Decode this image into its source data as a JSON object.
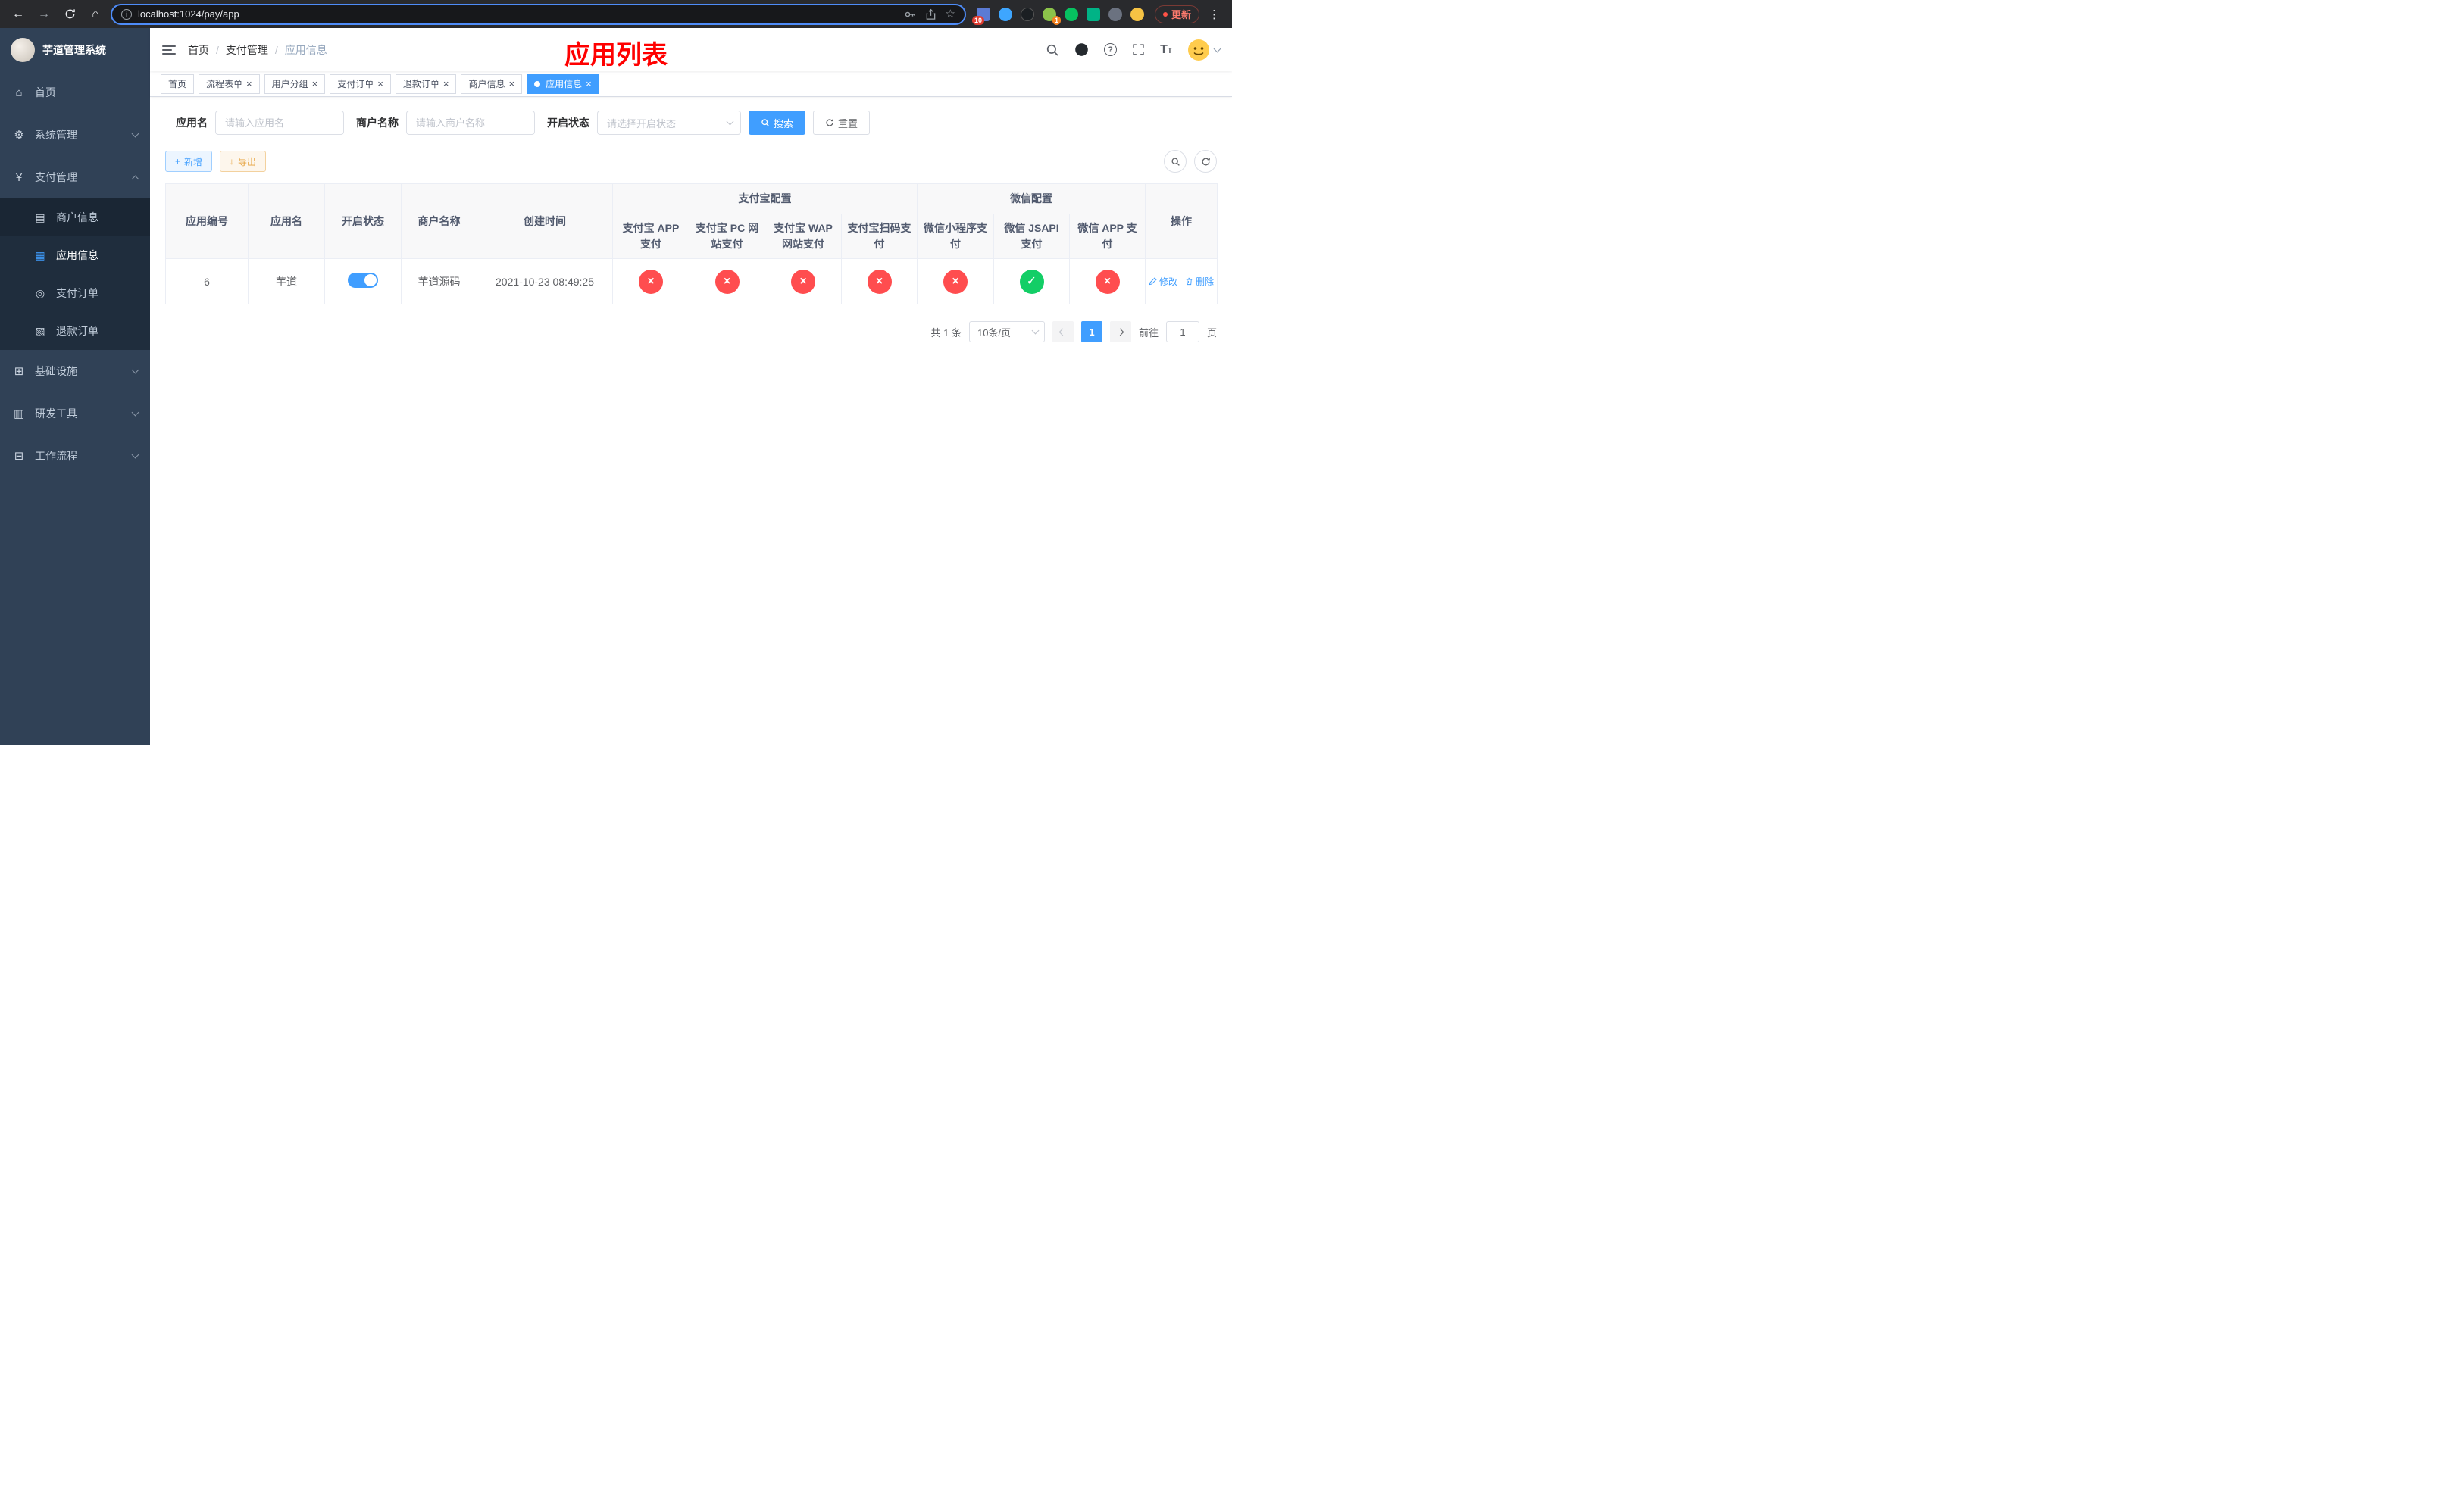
{
  "theme": {
    "accent": "#409eff",
    "sidebar_bg": "#304156",
    "submenu_bg": "#1f2d3d",
    "danger": "#ff4d4f",
    "success": "#13ce66",
    "overlay_title_color": "#ff0000"
  },
  "icons": {
    "close": "×",
    "check": "✓",
    "back": "←",
    "forward": "→",
    "home": "⌂",
    "star": "☆",
    "info": "i",
    "dots": "⋮",
    "question": "?",
    "font_large": "T",
    "font_small": "T"
  },
  "browser": {
    "url": "localhost:1024/pay/app",
    "update_label": "更新",
    "ext_badge_count": "10",
    "ext_badge_single": "1"
  },
  "sidebar": {
    "title": "芋道管理系统",
    "items": [
      {
        "label": "首页",
        "icon": "⌂"
      },
      {
        "label": "系统管理",
        "icon": "⚙"
      },
      {
        "label": "支付管理",
        "icon": "¥"
      },
      {
        "label": "基础设施",
        "icon": "⊞"
      },
      {
        "label": "研发工具",
        "icon": "▥"
      },
      {
        "label": "工作流程",
        "icon": "⊟"
      }
    ],
    "sub_items": [
      {
        "label": "商户信息",
        "icon": "▤"
      },
      {
        "label": "应用信息",
        "icon": "▦",
        "active": true
      },
      {
        "label": "支付订单",
        "icon": "◎"
      },
      {
        "label": "退款订单",
        "icon": "▧"
      }
    ]
  },
  "navbar": {
    "breadcrumb": [
      "首页",
      "支付管理",
      "应用信息"
    ],
    "separator": "/"
  },
  "page": {
    "overlay_title": "应用列表"
  },
  "tabs": [
    {
      "label": "首页",
      "closable": false
    },
    {
      "label": "流程表单",
      "closable": true
    },
    {
      "label": "用户分组",
      "closable": true
    },
    {
      "label": "支付订单",
      "closable": true
    },
    {
      "label": "退款订单",
      "closable": true
    },
    {
      "label": "商户信息",
      "closable": true
    },
    {
      "label": "应用信息",
      "closable": true,
      "active": true
    }
  ],
  "filters": {
    "app_name_label": "应用名",
    "app_name_placeholder": "请输入应用名",
    "merchant_label": "商户名称",
    "merchant_placeholder": "请输入商户名称",
    "status_label": "开启状态",
    "status_placeholder": "请选择开启状态",
    "search_label": "搜索",
    "reset_label": "重置"
  },
  "toolbar": {
    "add_label": "新增",
    "add_icon": "+",
    "export_label": "导出",
    "export_icon": "↓"
  },
  "table": {
    "headers": {
      "app_id": "应用编号",
      "app_name": "应用名",
      "status": "开启状态",
      "merchant": "商户名称",
      "created": "创建时间",
      "alipay_group": "支付宝配置",
      "wechat_group": "微信配置",
      "alipay_app": "支付宝 APP 支付",
      "alipay_pc": "支付宝 PC 网站支付",
      "alipay_wap": "支付宝 WAP 网站支付",
      "alipay_qr": "支付宝扫码支付",
      "wechat_lite": "微信小程序支付",
      "wechat_jsapi": "微信 JSAPI 支付",
      "wechat_app": "微信 APP 支付",
      "ops": "操作"
    },
    "row": {
      "app_id": "6",
      "app_name": "芋道",
      "status_on": true,
      "merchant": "芋道源码",
      "created": "2021-10-23 08:49:25",
      "alipay_app": false,
      "alipay_pc": false,
      "alipay_wap": false,
      "alipay_qr": false,
      "wechat_lite": false,
      "wechat_jsapi": true,
      "wechat_app": false,
      "edit_label": "修改",
      "delete_label": "删除"
    }
  },
  "pagination": {
    "total": "共 1 条",
    "page_size": "10条/页",
    "current_page": "1",
    "goto_prefix": "前往",
    "goto_value": "1",
    "goto_suffix": "页"
  }
}
